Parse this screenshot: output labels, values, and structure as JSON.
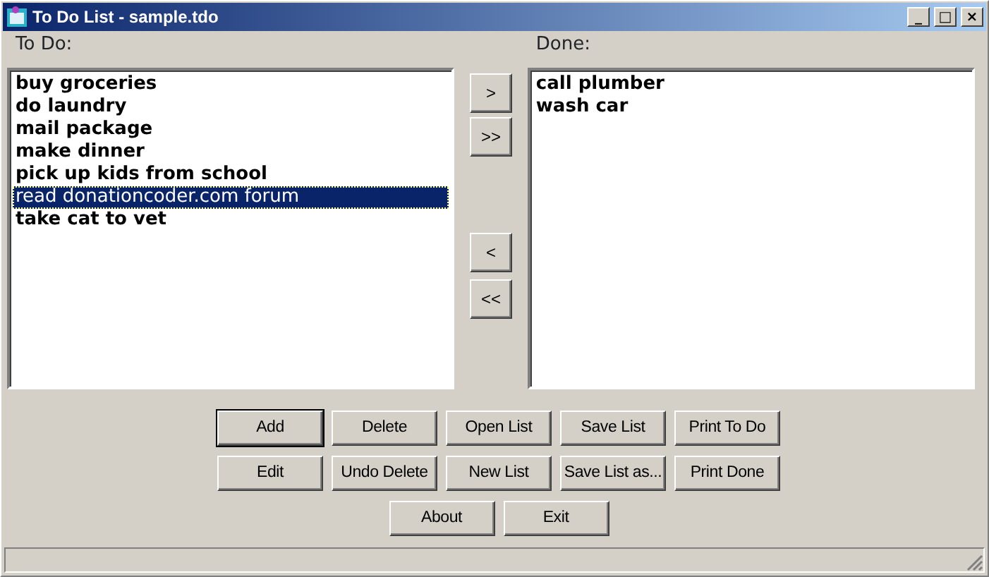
{
  "window": {
    "title": "To Do List - sample.tdo",
    "controls": [
      "_",
      "□",
      "×"
    ]
  },
  "todo": {
    "label": "To Do:",
    "items": [
      {
        "text": "buy groceries",
        "selected": false
      },
      {
        "text": "do laundry",
        "selected": false
      },
      {
        "text": "mail package",
        "selected": false
      },
      {
        "text": "make dinner",
        "selected": false
      },
      {
        "text": "pick up kids from school",
        "selected": false
      },
      {
        "text": "read donationcoder.com forum",
        "selected": true
      },
      {
        "text": "take cat to vet",
        "selected": false
      }
    ]
  },
  "move_buttons": [
    {
      "label": ">"
    },
    {
      "label": ">>"
    },
    {
      "label": "<"
    },
    {
      "label": "<<"
    }
  ],
  "done": {
    "label": "Done:",
    "items": [
      {
        "text": "call plumber",
        "selected": false
      },
      {
        "text": "wash car",
        "selected": false
      }
    ]
  },
  "buttons": [
    [
      {
        "label": "Add",
        "default": true
      },
      {
        "label": "Delete",
        "default": false
      },
      {
        "label": "Open List",
        "default": false
      },
      {
        "label": "Save List",
        "default": false
      },
      {
        "label": "Print To Do",
        "default": false
      }
    ],
    [
      {
        "label": "Edit",
        "default": false
      },
      {
        "label": "Undo Delete",
        "default": false
      },
      {
        "label": "New List",
        "default": false
      },
      {
        "label": "Save List as...",
        "default": false
      },
      {
        "label": "Print Done",
        "default": false
      }
    ],
    [
      {
        "label": "About",
        "default": false
      },
      {
        "label": "Exit",
        "default": false
      }
    ]
  ]
}
